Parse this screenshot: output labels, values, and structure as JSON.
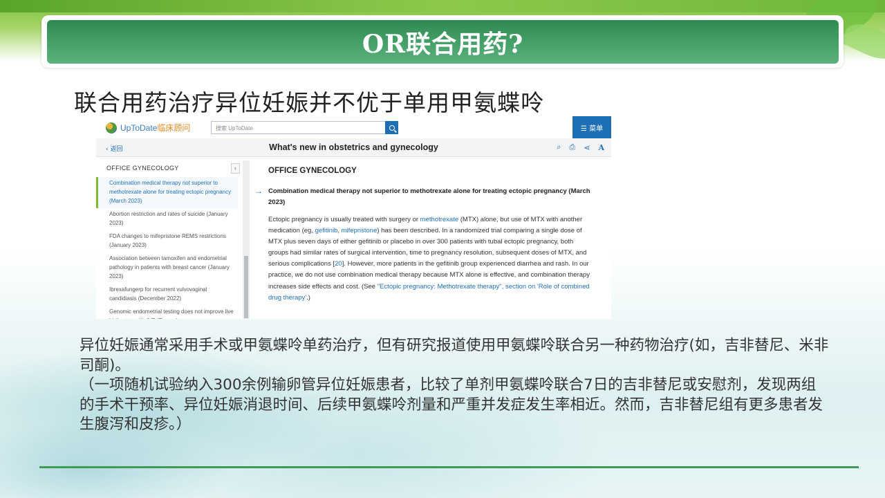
{
  "slide": {
    "title": "OR联合用药?",
    "subtitle": "联合用药治疗异位妊娠并不优于单用甲氨蝶呤",
    "body_paragraphs": [
      "异位妊娠通常采用手术或甲氨蝶呤单药治疗，但有研究报道使用甲氨蝶呤联合另一种药物治疗(如，吉非替尼、米非司酮)。",
      "（一项随机试验纳入300余例输卵管异位妊娠患者，比较了单剂甲氨蝶呤联合7日的吉非替尼或安慰剂，发现两组的手术干预率、异位妊娠消退时间、后续甲氨蝶呤剂量和严重并发症发生率相近。然而，吉非替尼组有更多患者发生腹泻和皮疹。）"
    ],
    "accent_color": "#3f9a55"
  },
  "utd": {
    "logo_text": "UpToDate",
    "logo_cn": "临床顾问",
    "search_placeholder": "搜索 UpToDate",
    "menu_label": "☰ 菜单",
    "back_label": "返回",
    "page_title": "What's new in obstetrics and gynecology",
    "tools": [
      "search-in-page-icon",
      "print-icon",
      "share-icon",
      "font-size-icon"
    ],
    "sidebar": {
      "heading": "OFFICE GYNECOLOGY",
      "items": [
        "Combination medical therapy not superior to methotrexate alone for treating ectopic pregnancy (March 2023)",
        "Abortion restriction and rates of suicide (January 2023)",
        "FDA changes to mifepristone REMS restrictions (January 2023)",
        "Association between tamoxifen and endometrial pathology in patients with breast cancer (January 2023)",
        "Ibrexafungerp for recurrent vulvovaginal candidiasis (December 2022)",
        "Genomic endometrial testing does not improve live birth rates with IVF (December"
      ]
    },
    "main": {
      "heading": "OFFICE GYNECOLOGY",
      "item_title": "Combination medical therapy not superior to methotrexate alone for treating ectopic pregnancy (March 2023)",
      "body_parts": [
        "Ectopic pregnancy is usually treated with surgery or ",
        "methotrexate",
        " (MTX) alone, but use of MTX with another medication (eg, ",
        "gefitinib",
        ", ",
        "mifepristone",
        ") has been described. In a randomized trial comparing a single dose of MTX plus seven days of either gefitinib or placebo in over 300 patients with tubal ectopic pregnancy, both groups had similar rates of surgical intervention, time to pregnancy resolution, subsequent doses of MTX, and serious complications [",
        "20",
        "]. However, more patients in the gefitinib group experienced diarrhea and rash. In our practice, we do not use combination medical therapy because MTX alone is effective, and combination therapy increases side effects and cost. (See ",
        "\"Ectopic pregnancy: Methotrexate therapy\", section on 'Role of combined drug therapy'",
        ".)"
      ]
    }
  }
}
